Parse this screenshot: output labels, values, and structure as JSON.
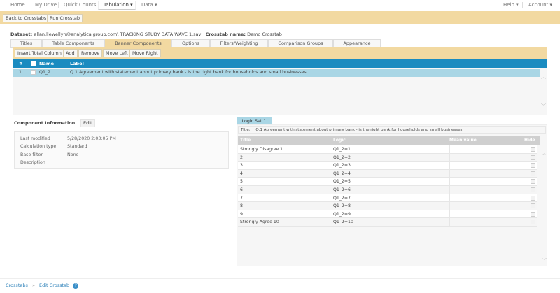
{
  "nav": {
    "home": "Home",
    "my_drive": "My Drive",
    "quick_counts": "Quick Counts",
    "tabulation": "Tabulation ▾",
    "data": "Data ▾",
    "help": "Help ▾",
    "account": "Account ▾"
  },
  "actions": {
    "back": "Back to Crosstabs",
    "run": "Run Crosstab"
  },
  "info": {
    "dataset_label": "Dataset:",
    "dataset": "allan.llewellyn@analyticalgroup.com\\ TRACKING STUDY DATA WAVE 1.sav",
    "crosstab_label": "Crosstab name:",
    "crosstab": "Demo Crosstab"
  },
  "tabs": [
    "Titles",
    "Table Components",
    "Banner Components",
    "Options",
    "Filters/Weighting",
    "Comparison Groups",
    "Appearance"
  ],
  "toolbar": [
    "Insert Total Column",
    "Add",
    "Remove",
    "Move Left",
    "Move Right"
  ],
  "grid": {
    "headers": {
      "num": "#",
      "name": "Name",
      "label": "Label"
    },
    "rows": [
      {
        "num": "1",
        "name": "Q1_2",
        "label": "Q.1 Agreement with statement about primary bank - is the right bank for households and small businesses"
      }
    ]
  },
  "component": {
    "title": "Component Information",
    "edit": "Edit",
    "fields": [
      {
        "k": "Last modified",
        "v": "5/28/2020 2:03:05 PM"
      },
      {
        "k": "Calculation type",
        "v": "Standard"
      },
      {
        "k": "Base filter",
        "v": "None"
      },
      {
        "k": "Description",
        "v": ""
      }
    ]
  },
  "logic": {
    "tab": "Logic Set 1",
    "title_label": "Title:",
    "title": "Q.1 Agreement with statement about primary bank - is the right bank for households and small businesses",
    "headers": {
      "title": "Title",
      "logic": "Logic",
      "mean": "Mean value",
      "hide": "Hide"
    },
    "rows": [
      {
        "t": "Strongly Disagree 1",
        "l": "Q1_2=1"
      },
      {
        "t": "2",
        "l": "Q1_2=2"
      },
      {
        "t": "3",
        "l": "Q1_2=3"
      },
      {
        "t": "4",
        "l": "Q1_2=4"
      },
      {
        "t": "5",
        "l": "Q1_2=5"
      },
      {
        "t": "6",
        "l": "Q1_2=6"
      },
      {
        "t": "7",
        "l": "Q1_2=7"
      },
      {
        "t": "8",
        "l": "Q1_2=8"
      },
      {
        "t": "9",
        "l": "Q1_2=9"
      },
      {
        "t": "Strongly Agree 10",
        "l": "Q1_2=10"
      }
    ]
  },
  "breadcrumb": {
    "crosstabs": "Crosstabs",
    "sep": "»",
    "edit": "Edit Crosstab"
  }
}
